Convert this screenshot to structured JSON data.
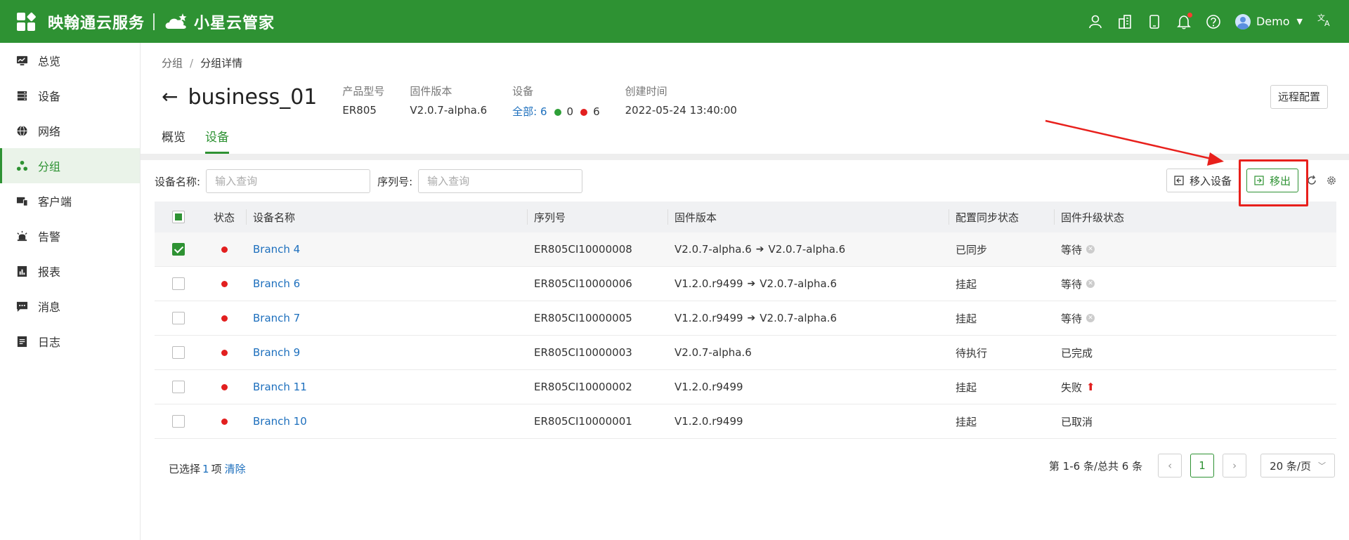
{
  "app": {
    "brand_primary": "映翰通云服务",
    "brand_secondary": "小星云管家",
    "accent_color": "#2e9233",
    "header_color": "#2e9233",
    "user": "Demo",
    "icons": [
      "user-outline-icon",
      "building-icon",
      "tablet-icon",
      "bell-icon",
      "help-icon",
      "translate-icon"
    ]
  },
  "sidebar": {
    "items": [
      {
        "label": "总览",
        "icon": "dashboard-icon"
      },
      {
        "label": "设备",
        "icon": "server-icon"
      },
      {
        "label": "网络",
        "icon": "globe-icon"
      },
      {
        "label": "分组",
        "icon": "group-icon",
        "active": true
      },
      {
        "label": "客户端",
        "icon": "client-icon"
      },
      {
        "label": "告警",
        "icon": "alarm-icon"
      },
      {
        "label": "报表",
        "icon": "report-icon"
      },
      {
        "label": "消息",
        "icon": "message-icon"
      },
      {
        "label": "日志",
        "icon": "log-icon"
      }
    ]
  },
  "breadcrumb": {
    "parent": "分组",
    "sep": "/",
    "current": "分组详情"
  },
  "header": {
    "title": "business_01",
    "product_model_label": "产品型号",
    "product_model": "ER805",
    "firmware_label": "固件版本",
    "firmware": "V2.0.7-alpha.6",
    "device_label": "设备",
    "device_all_label": "全部:",
    "device_all": "6",
    "device_online": "0",
    "device_offline": "6",
    "created_label": "创建时间",
    "created": "2022-05-24 13:40:00",
    "remote_config_label": "远程配置"
  },
  "tabs": [
    {
      "label": "概览"
    },
    {
      "label": "设备",
      "active": true
    }
  ],
  "filter": {
    "name_label": "设备名称:",
    "name_placeholder": "输入查询",
    "sn_label": "序列号:",
    "sn_placeholder": "输入查询"
  },
  "actions": {
    "move_in": "移入设备",
    "move_out": "移出"
  },
  "table": {
    "headers": [
      "状态",
      "设备名称",
      "序列号",
      "固件版本",
      "配置同步状态",
      "固件升级状态"
    ],
    "rows": [
      {
        "checked": true,
        "name": "Branch 4",
        "sn": "ER805CI10000008",
        "fw_from": "V2.0.7-alpha.6",
        "fw_to": "V2.0.7-alpha.6",
        "sync": "已同步",
        "upgrade": "等待",
        "upgrade_icon": "cancel"
      },
      {
        "checked": false,
        "name": "Branch 6",
        "sn": "ER805CI10000006",
        "fw_from": "V1.2.0.r9499",
        "fw_to": "V2.0.7-alpha.6",
        "sync": "挂起",
        "upgrade": "等待",
        "upgrade_icon": "cancel"
      },
      {
        "checked": false,
        "name": "Branch 7",
        "sn": "ER805CI10000005",
        "fw_from": "V1.2.0.r9499",
        "fw_to": "V2.0.7-alpha.6",
        "sync": "挂起",
        "upgrade": "等待",
        "upgrade_icon": "cancel"
      },
      {
        "checked": false,
        "name": "Branch 9",
        "sn": "ER805CI10000003",
        "fw_from": "V2.0.7-alpha.6",
        "fw_to": "",
        "sync": "待执行",
        "upgrade": "已完成",
        "upgrade_icon": ""
      },
      {
        "checked": false,
        "name": "Branch 11",
        "sn": "ER805CI10000002",
        "fw_from": "V1.2.0.r9499",
        "fw_to": "",
        "sync": "挂起",
        "upgrade": "失败",
        "upgrade_icon": "retry"
      },
      {
        "checked": false,
        "name": "Branch 10",
        "sn": "ER805CI10000001",
        "fw_from": "V1.2.0.r9499",
        "fw_to": "",
        "sync": "挂起",
        "upgrade": "已取消",
        "upgrade_icon": ""
      }
    ]
  },
  "footer": {
    "selected_prefix": "已选择",
    "selected_count": "1",
    "selected_suffix": "项",
    "clear": "清除",
    "total": "第 1-6 条/总共 6 条",
    "page": "1",
    "page_size": "20 条/页"
  }
}
